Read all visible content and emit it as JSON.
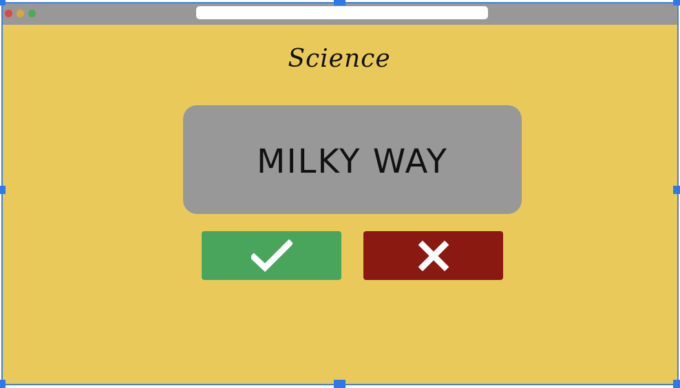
{
  "window": {
    "titlebar_color": "#999898",
    "background_color": "#e9c95a",
    "traffic_lights": [
      {
        "name": "close",
        "color": "#d94a3f"
      },
      {
        "name": "minimize",
        "color": "#d8a83a"
      },
      {
        "name": "maximize",
        "color": "#4ea85a"
      }
    ],
    "address_bar_value": ""
  },
  "app": {
    "title": "Science",
    "card": {
      "word": "MILKY WAY",
      "background_color": "#989898"
    },
    "buttons": {
      "correct": {
        "icon": "checkmark-icon",
        "color": "#49a55c"
      },
      "wrong": {
        "icon": "close-icon",
        "color": "#891911"
      }
    }
  },
  "selection": {
    "frame_color": "#3f7fd6",
    "handle_color": "#2f78e8"
  }
}
